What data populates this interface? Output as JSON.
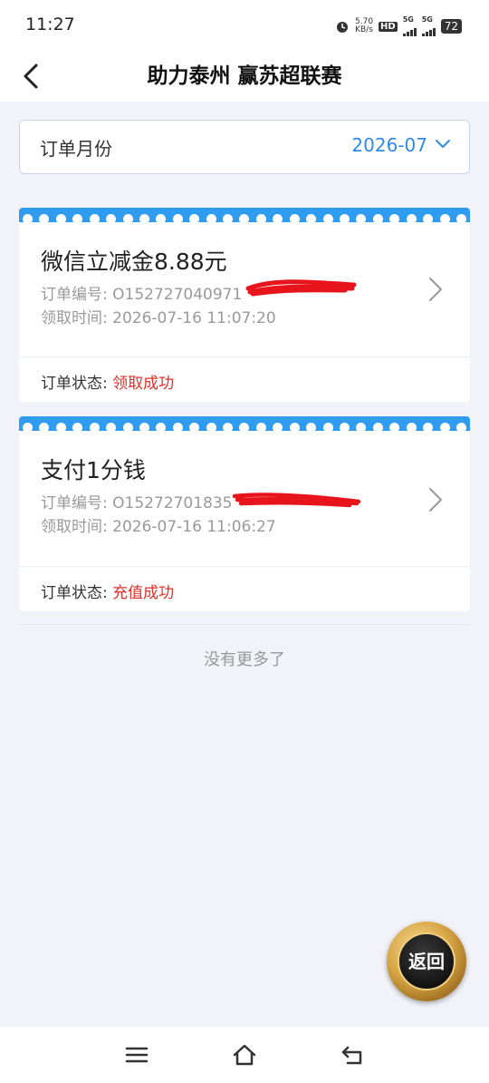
{
  "status_bar": {
    "time": "11:27",
    "net_speed_value": "5.70",
    "net_speed_unit": "KB/s",
    "hd_label": "HD",
    "signal1_label": "5G",
    "signal2_label": "5G",
    "battery": "72",
    "icons": [
      "alarm-icon",
      "hd-icon",
      "signal-icon",
      "signal-icon",
      "battery-icon"
    ]
  },
  "nav": {
    "title": "助力泰州 赢苏超联赛",
    "back_icon": "chevron-left-icon"
  },
  "month_filter": {
    "label": "订单月份",
    "value": "2026-07",
    "icon": "chevron-down-icon"
  },
  "orders": [
    {
      "name": "微信立减金8.88元",
      "order_no_label": "订单编号:",
      "order_no": "O152727040971",
      "time_label": "领取时间:",
      "time": "2026-07-16 11:07:20",
      "status_label": "订单状态:",
      "status": "领取成功"
    },
    {
      "name": "支付1分钱",
      "order_no_label": "订单编号:",
      "order_no": "O15272701835",
      "time_label": "领取时间:",
      "time": "2026-07-16 11:06:27",
      "status_label": "订单状态:",
      "status": "充值成功"
    }
  ],
  "footer_text": "没有更多了",
  "return_button": "返回",
  "colors": {
    "accent_blue": "#2f9cf0",
    "link_blue": "#2f8ae6",
    "status_red": "#e0302a",
    "background": "#f2f3f8"
  },
  "system_nav": [
    "menu-icon",
    "home-icon",
    "back-icon"
  ]
}
